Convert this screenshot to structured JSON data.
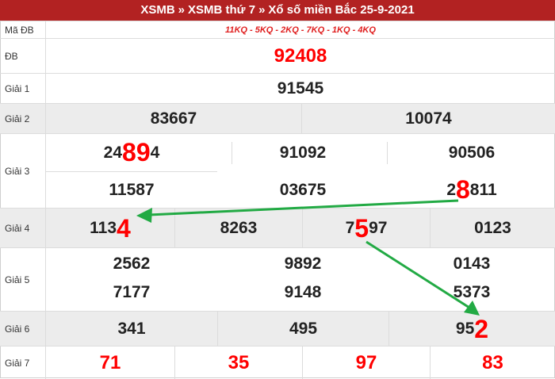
{
  "header": {
    "crumb1": "XSMB",
    "sep": "»",
    "crumb2": "XSMB thứ 7",
    "crumb3": "Xổ số miền Bắc 25-9-2021"
  },
  "rows": {
    "ma_db": {
      "label": "Mã ĐB",
      "value": "11KQ - 5KQ - 2KQ - 7KQ - 1KQ - 4KQ"
    },
    "db": {
      "label": "ĐB",
      "value": "92408"
    },
    "g1": {
      "label": "Giải 1",
      "value": "91545"
    },
    "g2": {
      "label": "Giải 2",
      "values": [
        "83667",
        "10074"
      ]
    },
    "g3": {
      "label": "Giải 3",
      "n1": {
        "a": "24",
        "b": "89",
        "c": "4"
      },
      "n2": "91092",
      "n3": "90506",
      "n4": "11587",
      "n5": "03675",
      "n6": {
        "a": "2",
        "b": "8",
        "c": "811"
      }
    },
    "g4": {
      "label": "Giải 4",
      "n1": {
        "a": "113",
        "b": "4"
      },
      "n2": "8263",
      "n3": {
        "a": "7",
        "b": "5",
        "c": "97"
      },
      "n4": "0123"
    },
    "g5": {
      "label": "Giải 5",
      "values": [
        "2562",
        "9892",
        "0143",
        "7177",
        "9148",
        "5373"
      ]
    },
    "g6": {
      "label": "Giải 6",
      "n1": "341",
      "n2": "495",
      "n3": {
        "a": "95",
        "b": "2"
      }
    },
    "g7": {
      "label": "Giải 7",
      "values": [
        "71",
        "35",
        "97",
        "83"
      ]
    }
  },
  "colors": {
    "header_bg": "#b22222",
    "highlight": "#ff0000",
    "arrow": "#22aa44",
    "alt_row": "#ececec"
  }
}
